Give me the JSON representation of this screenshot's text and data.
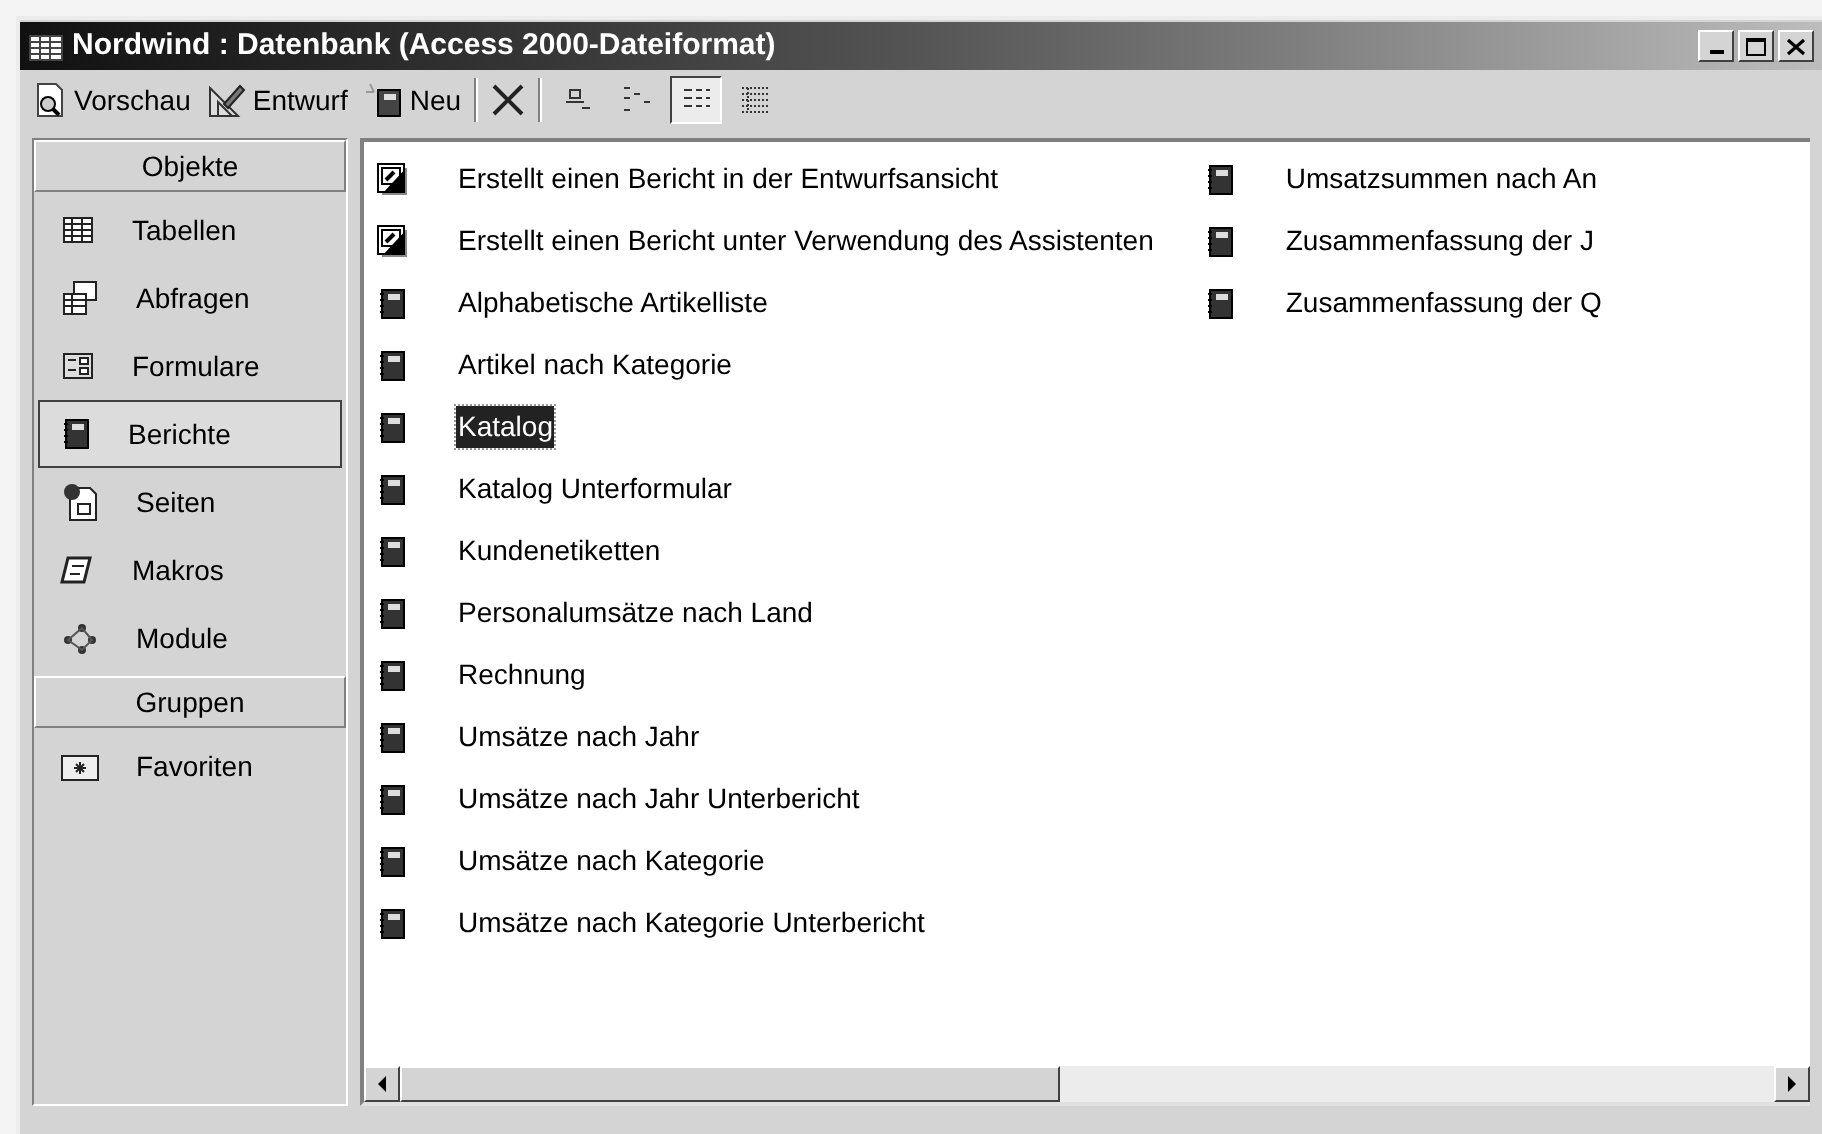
{
  "window": {
    "title": "Nordwind : Datenbank (Access 2000-Dateiformat)"
  },
  "toolbar": {
    "buttons": [
      {
        "label": "Vorschau",
        "kind": "preview"
      },
      {
        "label": "Entwurf",
        "kind": "design"
      },
      {
        "label": "Neu",
        "kind": "new"
      },
      {
        "kind": "delete"
      }
    ],
    "view_buttons": [
      {
        "kind": "large",
        "selected": false
      },
      {
        "kind": "small",
        "selected": false
      },
      {
        "kind": "list",
        "selected": true
      },
      {
        "kind": "details",
        "selected": false
      }
    ]
  },
  "sidebar": {
    "sections": [
      {
        "title": "Objekte",
        "items": [
          {
            "label": "Tabellen",
            "kind": "tables",
            "selected": false
          },
          {
            "label": "Abfragen",
            "kind": "queries",
            "selected": false
          },
          {
            "label": "Formulare",
            "kind": "forms",
            "selected": false
          },
          {
            "label": "Berichte",
            "kind": "reports",
            "selected": true
          },
          {
            "label": "Seiten",
            "kind": "pages",
            "selected": false
          },
          {
            "label": "Makros",
            "kind": "macros",
            "selected": false
          },
          {
            "label": "Module",
            "kind": "modules",
            "selected": false
          }
        ]
      },
      {
        "title": "Gruppen",
        "items": [
          {
            "label": "Favoriten",
            "kind": "favorites",
            "selected": false
          }
        ]
      }
    ]
  },
  "list": {
    "columns": [
      [
        {
          "label": "Erstellt einen Bericht in der Entwurfsansicht",
          "kind": "wizard",
          "selected": false
        },
        {
          "label": "Erstellt einen Bericht unter Verwendung des Assistenten",
          "kind": "wizard",
          "selected": false
        },
        {
          "label": "Alphabetische Artikelliste",
          "kind": "report",
          "selected": false
        },
        {
          "label": "Artikel nach Kategorie",
          "kind": "report",
          "selected": false
        },
        {
          "label": "Katalog",
          "kind": "report",
          "selected": true
        },
        {
          "label": "Katalog Unterformular",
          "kind": "report",
          "selected": false
        },
        {
          "label": "Kundenetiketten",
          "kind": "report",
          "selected": false
        },
        {
          "label": "Personalumsätze nach Land",
          "kind": "report",
          "selected": false
        },
        {
          "label": "Rechnung",
          "kind": "report",
          "selected": false
        },
        {
          "label": "Umsätze nach Jahr",
          "kind": "report",
          "selected": false
        },
        {
          "label": "Umsätze nach Jahr Unterbericht",
          "kind": "report",
          "selected": false
        },
        {
          "label": "Umsätze nach Kategorie",
          "kind": "report",
          "selected": false
        },
        {
          "label": "Umsätze nach Kategorie Unterbericht",
          "kind": "report",
          "selected": false
        }
      ],
      [
        {
          "label": "Umsatzsummen nach An",
          "kind": "report",
          "selected": false
        },
        {
          "label": "Zusammenfassung der J",
          "kind": "report",
          "selected": false
        },
        {
          "label": "Zusammenfassung der Q",
          "kind": "report",
          "selected": false
        }
      ]
    ]
  }
}
